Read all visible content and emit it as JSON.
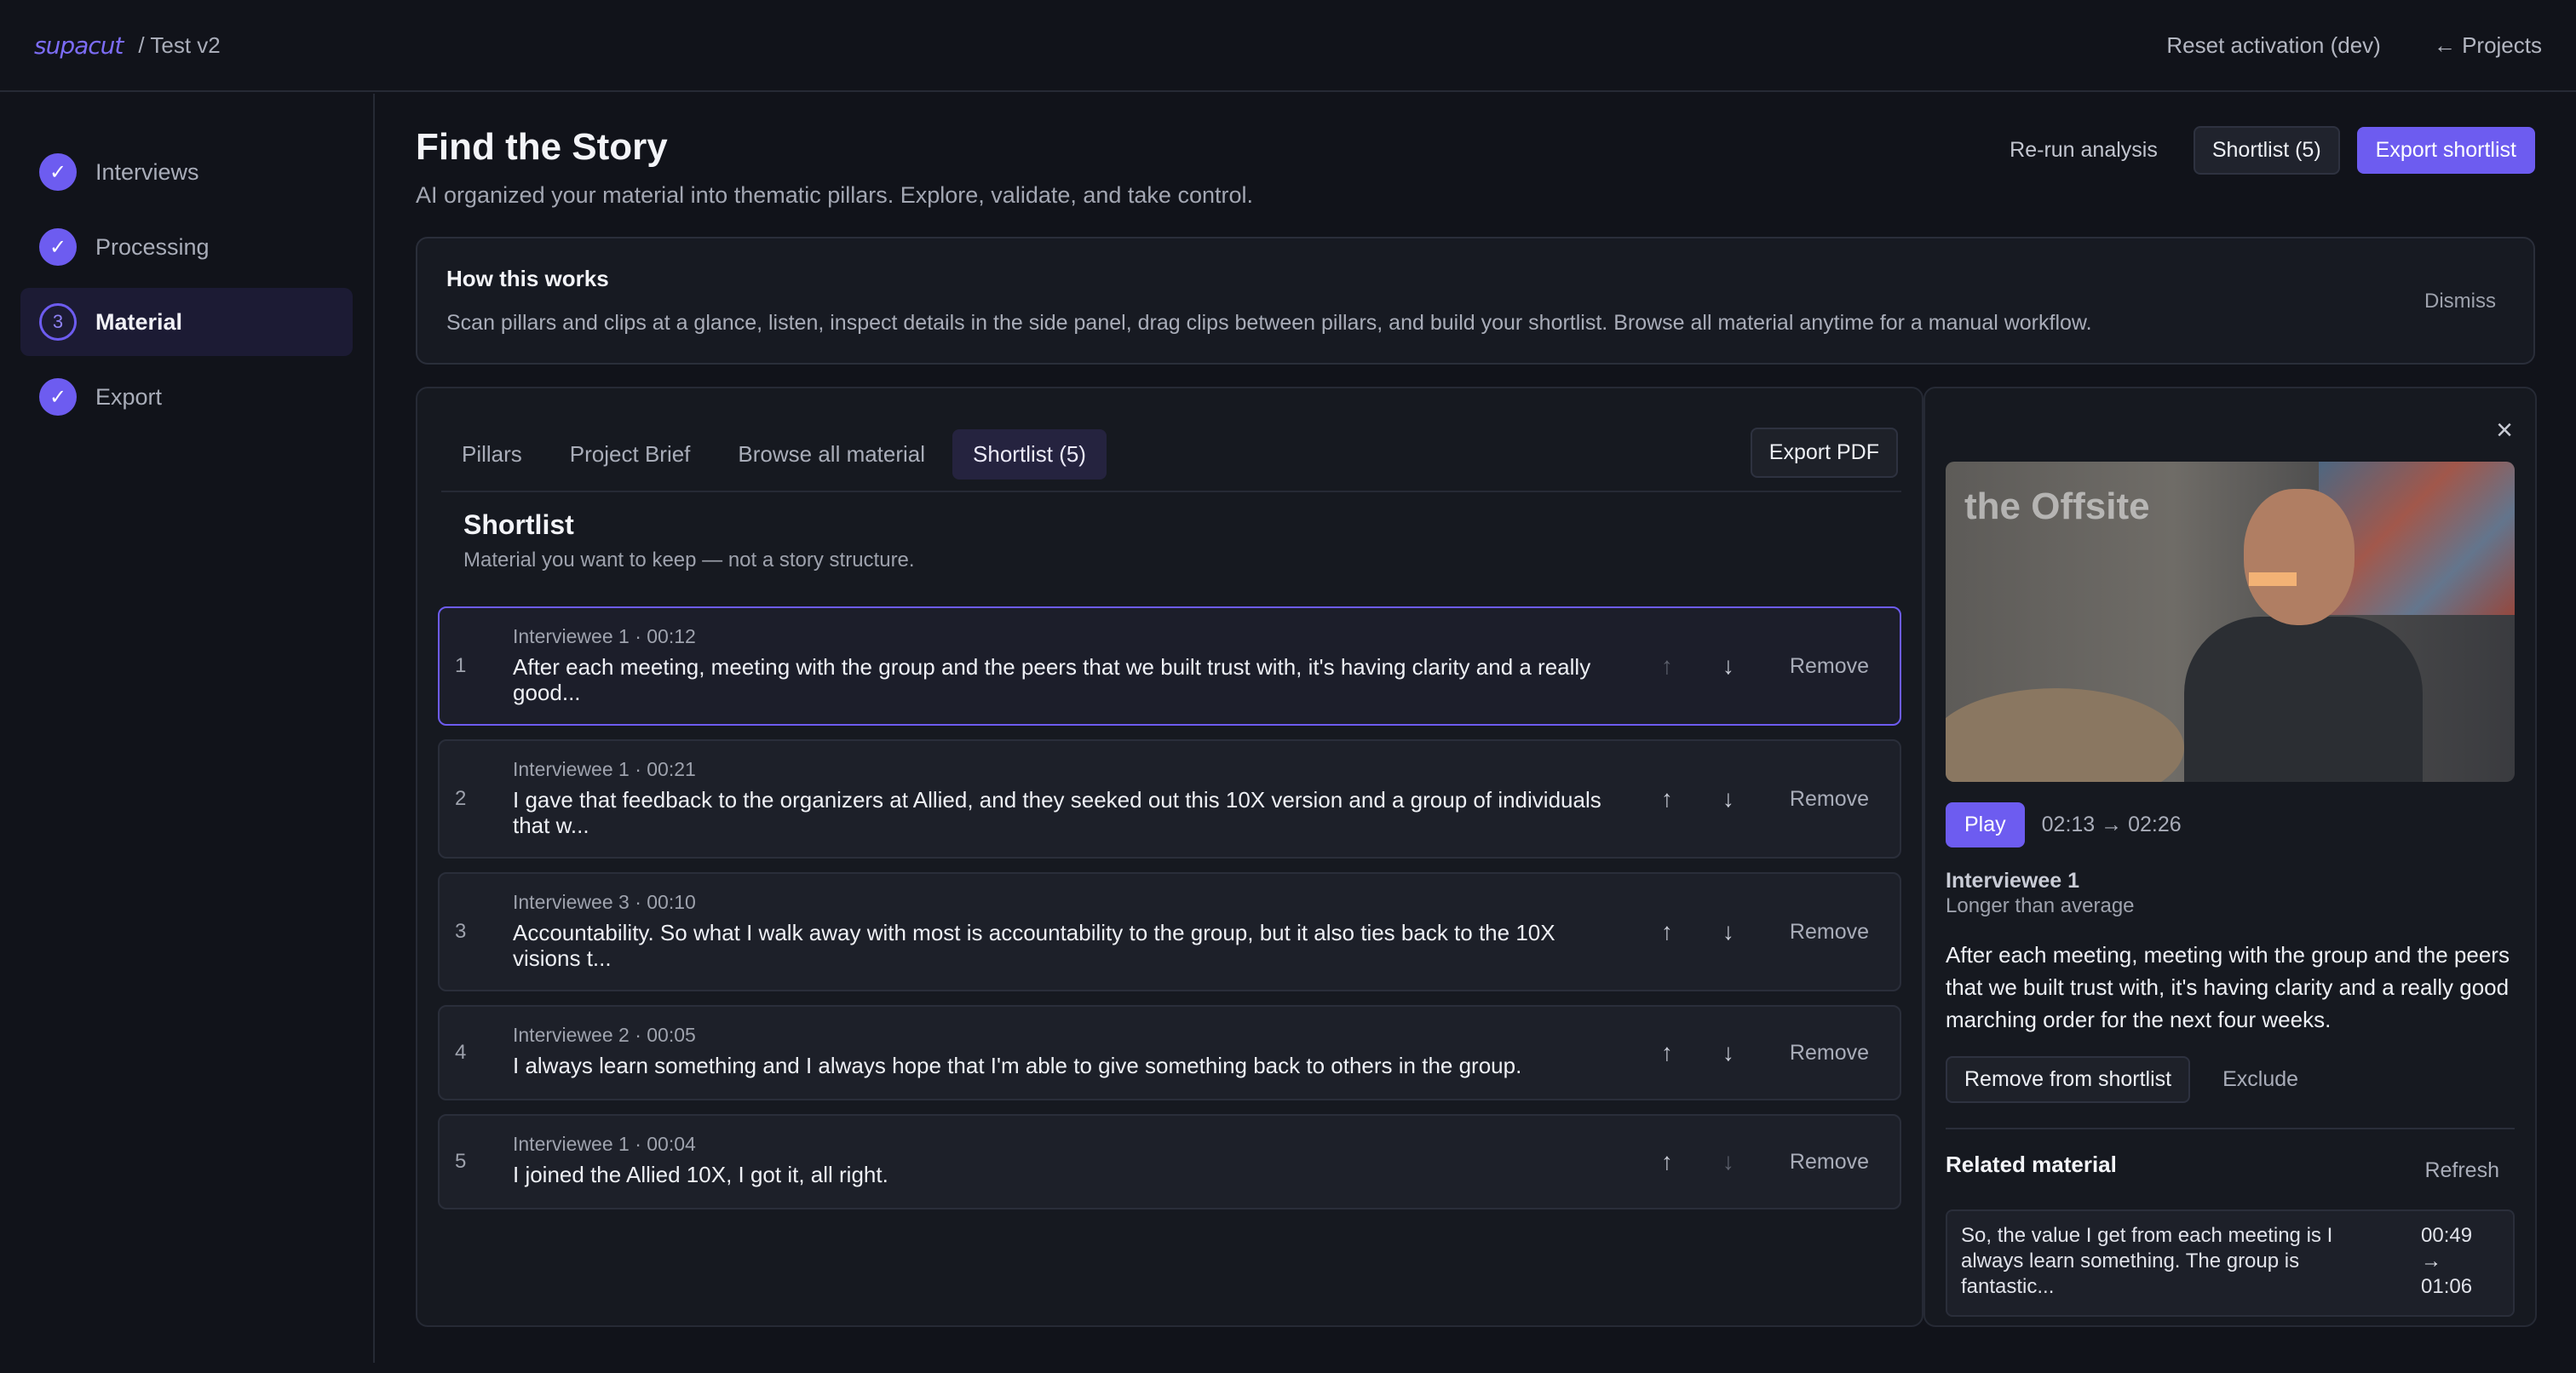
{
  "topbar": {
    "logo": "supacut",
    "breadcrumb": "/ Test v2",
    "reset_label": "Reset activation (dev)",
    "projects_label": "← Projects"
  },
  "sidebar": {
    "steps": [
      {
        "label": "Interviews",
        "state": "done",
        "badge": "✓"
      },
      {
        "label": "Processing",
        "state": "done",
        "badge": "✓"
      },
      {
        "label": "Material",
        "state": "active",
        "badge": "3"
      },
      {
        "label": "Export",
        "state": "done",
        "badge": "✓"
      }
    ]
  },
  "header": {
    "title": "Find the Story",
    "subtitle": "AI organized your material into thematic pillars. Explore, validate, and take control.",
    "rerun_label": "Re-run analysis",
    "shortlist_label": "Shortlist (5)",
    "export_label": "Export shortlist"
  },
  "how": {
    "title": "How this works",
    "body": "Scan pillars and clips at a glance, listen, inspect details in the side panel, drag clips between pillars, and build your shortlist. Browse all material anytime for a manual workflow.",
    "dismiss_label": "Dismiss"
  },
  "tabs": {
    "items": [
      "Pillars",
      "Project Brief",
      "Browse all material",
      "Shortlist (5)"
    ],
    "export_pdf": "Export PDF"
  },
  "shortlist": {
    "title": "Shortlist",
    "subtitle": "Material you want to keep — not a story structure.",
    "remove_label": "Remove",
    "up_arrow": "↑",
    "down_arrow": "↓",
    "rows": [
      {
        "index": "1",
        "meta": "Interviewee 1 · 00:12",
        "text": "After each meeting, meeting with the group and the peers that we built trust with, it's having clarity and a really good..."
      },
      {
        "index": "2",
        "meta": "Interviewee 1 · 00:21",
        "text": "I gave that feedback to the organizers at Allied, and they seeked out this 10X version and a group of individuals that w..."
      },
      {
        "index": "3",
        "meta": "Interviewee 3 · 00:10",
        "text": "Accountability. So what I walk away with most is accountability to the group, but it also ties back to the 10X visions t..."
      },
      {
        "index": "4",
        "meta": "Interviewee 2 · 00:05",
        "text": "I always learn something and I always hope that I'm able to give something back to others in the group."
      },
      {
        "index": "5",
        "meta": "Interviewee 1 · 00:04",
        "text": "I joined the Allied 10X, I got it, all right."
      }
    ]
  },
  "detail": {
    "close_icon": "×",
    "video_sign": "the Offsite",
    "play_label": "Play",
    "timecode": "02:13 → 02:26",
    "speaker": "Interviewee 1",
    "speaker_note": "Longer than average",
    "quote": "After each meeting, meeting with the group and the peers that we built trust with, it's having clarity and a really good marching order for the next four weeks.",
    "remove_shortlist_label": "Remove from shortlist",
    "exclude_label": "Exclude",
    "related_title": "Related material",
    "refresh_label": "Refresh",
    "related": [
      {
        "text": "So, the value I get from each meeting is I always learn something. The group is fantastic...",
        "time": "00:49 → 01:06"
      }
    ]
  },
  "colors": {
    "accent": "#6d5cf0",
    "background": "#11131a",
    "panel": "#161920"
  }
}
